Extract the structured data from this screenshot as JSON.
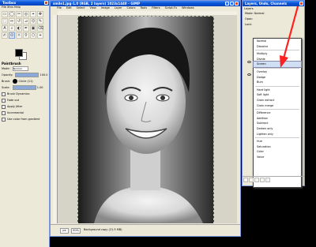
{
  "toolbox": {
    "title": "Toolbox",
    "menu": "File  Xtns  Help",
    "tool_glyphs": [
      "▭",
      "◯",
      "✂",
      "◎",
      "⌖",
      "✥",
      "⬚",
      "⇔",
      "↺",
      "⊿",
      "⌬",
      "✎",
      "A",
      "⌕",
      "◐",
      "✒",
      "▣",
      "⌫",
      "✍",
      "⊙",
      "☼",
      "⚲",
      "⬡",
      "⌖"
    ],
    "options": {
      "title": "Paintbrush",
      "mode_label": "Mode:",
      "mode_value": "Normal",
      "opacity_label": "Opacity:",
      "opacity_value": "100.0",
      "brush_label": "Brush:",
      "brush_value": "Circle (11)",
      "scale_label": "Scale:",
      "scale_value": "1.00",
      "checks": [
        "Brush Dynamics",
        "Fade out",
        "Apply Jitter",
        "Incremental",
        "Use color from gradient"
      ]
    },
    "colors": {
      "fg": "#000000",
      "bg": "#ffffff"
    }
  },
  "image_window": {
    "title": "smile1.jpg-1.0 (RGB, 2 layers) 1023x1440 – GIMP",
    "menu": [
      "File",
      "Edit",
      "Select",
      "View",
      "Image",
      "Layer",
      "Colors",
      "Tools",
      "Filters",
      "Script-Fu",
      "Windows"
    ],
    "unit": "px",
    "zoom": "50%",
    "status": "Background copy (21.5 MB)"
  },
  "layers": {
    "title": "Layers, Undo, Channels",
    "tab": "Layers",
    "mode_label": "Mode:",
    "mode_value": "Normal",
    "opacity_label": "Opac:",
    "lock_label": "Lock:",
    "blend_modes": [
      "Normal",
      "Dissolve",
      "Multiply",
      "Divide",
      "Screen",
      "Overlay",
      "Dodge",
      "Burn",
      "Hard light",
      "Soft light",
      "Grain extract",
      "Grain merge",
      "Difference",
      "Addition",
      "Subtract",
      "Darken only",
      "Lighten only",
      "Hue",
      "Saturation",
      "Color",
      "Value"
    ],
    "highlighted": "Screen"
  },
  "annotation": {
    "arrow_color": "#ff2020"
  }
}
